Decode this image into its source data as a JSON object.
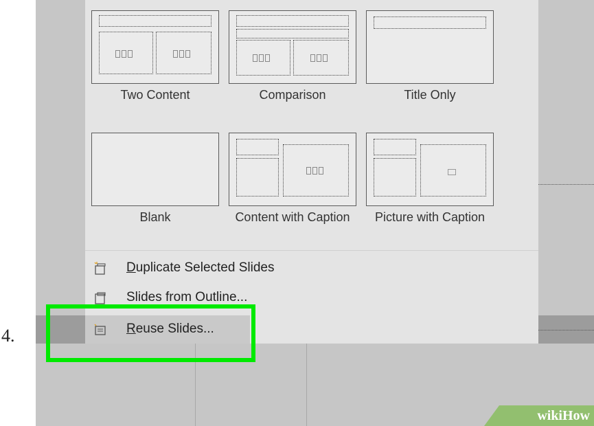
{
  "step": {
    "number": "4."
  },
  "layouts": [
    {
      "label": "Two Content"
    },
    {
      "label": "Comparison"
    },
    {
      "label": "Title Only"
    },
    {
      "label": "Blank"
    },
    {
      "label": "Content with Caption"
    },
    {
      "label": "Picture with Caption"
    }
  ],
  "menu": {
    "items": [
      {
        "label": "Duplicate Selected Slides",
        "accesskey": "D"
      },
      {
        "label": "Slides from Outline...",
        "accesskey": ""
      },
      {
        "label": "Reuse Slides...",
        "accesskey": "R",
        "highlighted": true
      }
    ]
  },
  "watermark": {
    "text": "wikiHow"
  },
  "colors": {
    "highlight": "#00ea00",
    "watermark_bg": "#92bf6f"
  }
}
